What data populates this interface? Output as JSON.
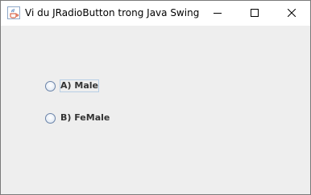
{
  "window": {
    "title": "Vi du JRadioButton trong Java Swing",
    "app_icon": "java-cup-icon"
  },
  "controls": {
    "minimize_icon": "minimize-icon",
    "maximize_icon": "maximize-icon",
    "close_icon": "close-icon"
  },
  "radios": [
    {
      "label": "A) Male",
      "selected": false,
      "focused": true
    },
    {
      "label": "B) FeMale",
      "selected": false,
      "focused": false
    }
  ],
  "colors": {
    "content_background": "#eeeeee",
    "titlebar_background": "#ffffff",
    "label_text": "#333333",
    "focus_border": "#b8cfe5"
  }
}
